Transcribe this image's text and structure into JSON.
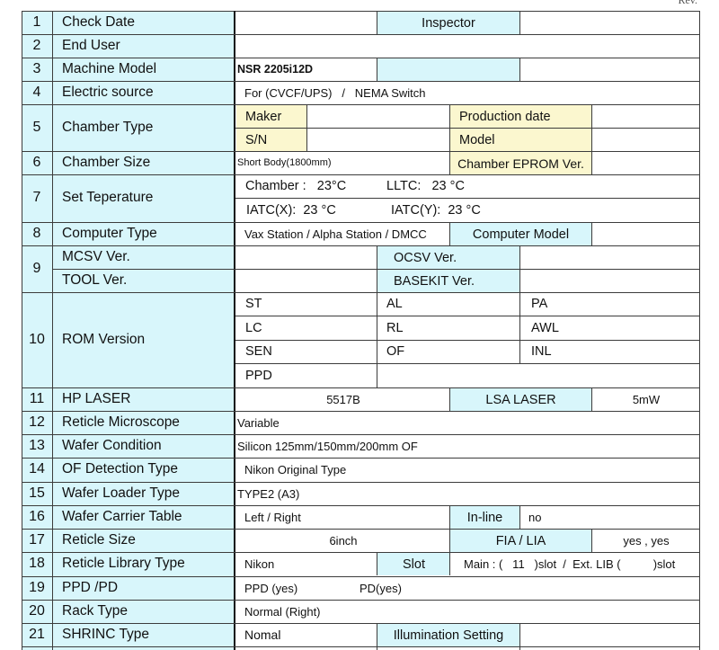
{
  "rev": "Rev.",
  "rows": {
    "r1": {
      "num": "1",
      "label": "Check Date",
      "inspector": "Inspector"
    },
    "r2": {
      "num": "2",
      "label": "End User"
    },
    "r3": {
      "num": "3",
      "label": "Machine Model",
      "value": "NSR 2205i12D"
    },
    "r4": {
      "num": "4",
      "label": "Electric source",
      "value": "For (CVCF/UPS)   /   NEMA Switch"
    },
    "r5": {
      "num": "5",
      "label": "Chamber Type",
      "maker": "Maker",
      "sn": "S/N",
      "production_date": "Production date",
      "model": "Model"
    },
    "r6": {
      "num": "6",
      "label": "Chamber Size",
      "value": "Short Body(1800mm)",
      "eprom": "Chamber EPROM Ver."
    },
    "r7": {
      "num": "7",
      "label": "Set Teperature",
      "chamber": "Chamber :   23°C",
      "lltc": "LLTC:   23 °C",
      "iatc_x": "IATC(X):  23 °C",
      "iatc_y": "IATC(Y):  23 °C"
    },
    "r8": {
      "num": "8",
      "label": "Computer Type",
      "value": "Vax Station / Alpha Station / DMCC",
      "computer_model": "Computer Model"
    },
    "r9": {
      "num": "9",
      "mcsv": "MCSV Ver.",
      "tool": "TOOL Ver.",
      "ocsv": "OCSV Ver.",
      "basekit": "BASEKIT Ver."
    },
    "r10": {
      "num": "10",
      "label": "ROM Version",
      "items": [
        "ST",
        "AL",
        "PA",
        "LC",
        "RL",
        "AWL",
        "SEN",
        "OF",
        "INL",
        "PPD"
      ]
    },
    "r11": {
      "num": "11",
      "label": "HP LASER",
      "hp_value": "5517B",
      "lsa": "LSA LASER",
      "lsa_value": "5mW"
    },
    "r12": {
      "num": "12",
      "label": "Reticle Microscope",
      "value": "Variable"
    },
    "r13": {
      "num": "13",
      "label": "Wafer Condition",
      "value": "Silicon 125mm/150mm/200mm OF"
    },
    "r14": {
      "num": "14",
      "label": "OF Detection Type",
      "value": "Nikon Original Type"
    },
    "r15": {
      "num": "15",
      "label": "Wafer Loader Type",
      "value": "TYPE2 (A3)"
    },
    "r16": {
      "num": "16",
      "label": "Wafer Carrier Table",
      "value": "Left / Right",
      "inline": "In-line",
      "inline_value": "no"
    },
    "r17": {
      "num": "17",
      "label": "Reticle Size",
      "value": "6inch",
      "fia": "FIA / LIA",
      "fia_value": "yes , yes"
    },
    "r18": {
      "num": "18",
      "label": "Reticle Library Type",
      "value": "Nikon",
      "slot": "Slot",
      "slot_value": "Main : (   11   )slot  /  Ext. LIB (          )slot"
    },
    "r19": {
      "num": "19",
      "label": "PPD /PD",
      "ppd": "PPD (yes)",
      "pd": "PD(yes)"
    },
    "r20": {
      "num": "20",
      "label": "Rack Type",
      "value": "Normal (Right)"
    },
    "r21": {
      "num": "21",
      "label": "SHRINC Type",
      "value": "Nomal",
      "illum": "Illumination Setting"
    }
  }
}
